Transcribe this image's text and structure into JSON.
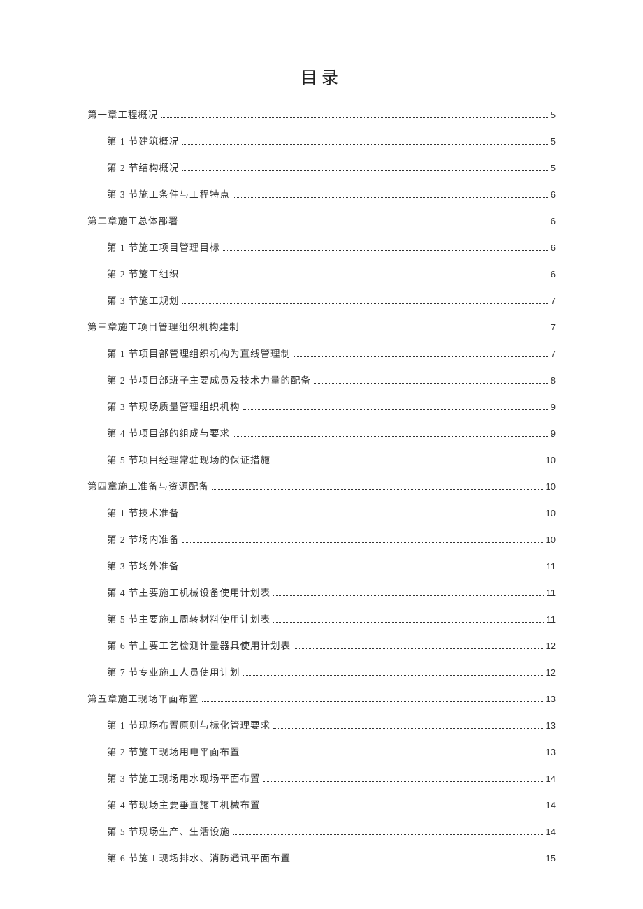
{
  "title": "目录",
  "entries": [
    {
      "level": 1,
      "label": "第一章工程概况",
      "page": "5"
    },
    {
      "level": 2,
      "label": "第 1 节建筑概况",
      "page": "5"
    },
    {
      "level": 2,
      "label": "第 2 节结构概况",
      "page": "5"
    },
    {
      "level": 2,
      "label": "第 3 节施工条件与工程特点",
      "page": "6"
    },
    {
      "level": 1,
      "label": "第二章施工总体部署",
      "page": "6"
    },
    {
      "level": 2,
      "label": "第 1 节施工项目管理目标",
      "page": "6"
    },
    {
      "level": 2,
      "label": "第 2 节施工组织",
      "page": "6"
    },
    {
      "level": 2,
      "label": "第 3 节施工规划",
      "page": "7"
    },
    {
      "level": 1,
      "label": "第三章施工项目管理组织机构建制",
      "page": "7"
    },
    {
      "level": 2,
      "label": "第 1 节项目部管理组织机构为直线管理制",
      "page": "7"
    },
    {
      "level": 2,
      "label": "第 2 节项目部班子主要成员及技术力量的配备",
      "page": "8"
    },
    {
      "level": 2,
      "label": "第 3 节现场质量管理组织机构",
      "page": "9"
    },
    {
      "level": 2,
      "label": "第 4 节项目部的组成与要求",
      "page": "9"
    },
    {
      "level": 2,
      "label": "第 5 节项目经理常驻现场的保证措施",
      "page": "10"
    },
    {
      "level": 1,
      "label": "第四章施工准备与资源配备",
      "page": "10"
    },
    {
      "level": 2,
      "label": "第 1 节技术准备",
      "page": "10"
    },
    {
      "level": 2,
      "label": "第 2 节场内准备",
      "page": "10"
    },
    {
      "level": 2,
      "label": "第 3 节场外准备",
      "page": "11"
    },
    {
      "level": 2,
      "label": "第 4 节主要施工机械设备使用计划表",
      "page": "11"
    },
    {
      "level": 2,
      "label": "第 5 节主要施工周转材料使用计划表",
      "page": "11"
    },
    {
      "level": 2,
      "label": "第 6 节主要工艺检测计量器具使用计划表",
      "page": "12"
    },
    {
      "level": 2,
      "label": "第 7 节专业施工人员使用计划",
      "page": "12"
    },
    {
      "level": 1,
      "label": "第五章施工现场平面布置",
      "page": "13"
    },
    {
      "level": 2,
      "label": "第 1 节现场布置原则与标化管理要求",
      "page": "13"
    },
    {
      "level": 2,
      "label": "第 2 节施工现场用电平面布置",
      "page": "13"
    },
    {
      "level": 2,
      "label": "第 3 节施工现场用水现场平面布置",
      "page": "14"
    },
    {
      "level": 2,
      "label": "第 4 节现场主要垂直施工机械布置",
      "page": "14"
    },
    {
      "level": 2,
      "label": "第 5 节现场生产、生活设施",
      "page": "14"
    },
    {
      "level": 2,
      "label": "第 6 节施工现场排水、消防通讯平面布置",
      "page": "15"
    }
  ]
}
